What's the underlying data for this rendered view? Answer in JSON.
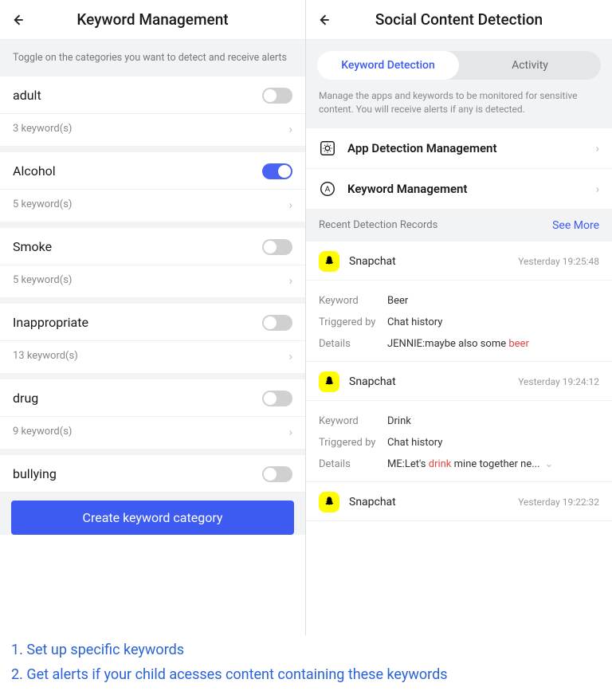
{
  "left": {
    "header_title": "Keyword Management",
    "intro": "Toggle on the categories you want to detect and receive alerts",
    "categories": [
      {
        "name": "adult",
        "count": "3 keyword(s)",
        "on": false
      },
      {
        "name": "Alcohol",
        "count": "5 keyword(s)",
        "on": true
      },
      {
        "name": "Smoke",
        "count": "5 keyword(s)",
        "on": false
      },
      {
        "name": "Inappropriate",
        "count": "13 keyword(s)",
        "on": false
      },
      {
        "name": "drug",
        "count": "9 keyword(s)",
        "on": false
      },
      {
        "name": "bullying",
        "count": "",
        "on": false,
        "no_bottom": true
      }
    ],
    "create_label": "Create keyword category"
  },
  "right": {
    "header_title": "Social Content Detection",
    "tabs": {
      "keyword": "Keyword Detection",
      "activity": "Activity"
    },
    "desc": "Manage the apps and keywords to be monitored for sensitive content. You will receive alerts if any is detected.",
    "mgmt": {
      "app": "App Detection Management",
      "keyword": "Keyword Management"
    },
    "recent_label": "Recent Detection Records",
    "see_more": "See More",
    "records": [
      {
        "app": "Snapchat",
        "time": "Yesterday 19:25:48",
        "keyword_label": "Keyword",
        "keyword": "Beer",
        "triggered_label": "Triggered by",
        "triggered": "Chat history",
        "details_label": "Details",
        "details_pre": "JENNIE:maybe also some ",
        "details_kw": "beer",
        "details_post": ""
      },
      {
        "app": "Snapchat",
        "time": "Yesterday 19:24:12",
        "keyword_label": "Keyword",
        "keyword": "Drink",
        "triggered_label": "Triggered by",
        "triggered": "Chat history",
        "details_label": "Details",
        "details_pre": "ME:Let's ",
        "details_kw": "drink",
        "details_post": " mine together ne...",
        "expand": true
      },
      {
        "app": "Snapchat",
        "time": "Yesterday 19:22:32"
      }
    ]
  },
  "footer": {
    "line1": "1. Set up specific keywords",
    "line2": "2. Get alerts if your child acesses content containing these keywords"
  }
}
